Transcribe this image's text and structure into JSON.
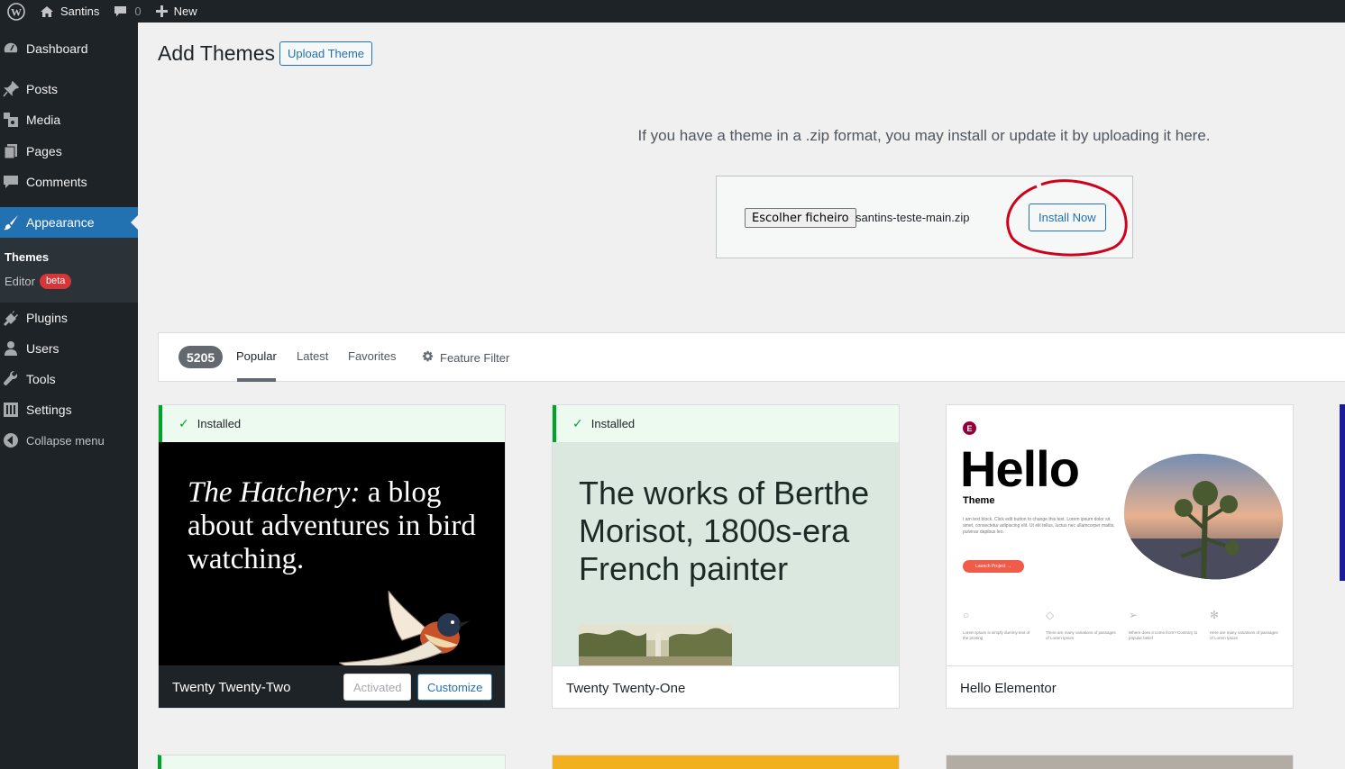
{
  "adminbar": {
    "site_name": "Santins",
    "comments_count": "0",
    "new_label": "New"
  },
  "sidebar": {
    "items": [
      {
        "label": "Dashboard",
        "icon": "dashboard-icon"
      },
      {
        "label": "Posts",
        "icon": "pin-icon"
      },
      {
        "label": "Media",
        "icon": "media-icon"
      },
      {
        "label": "Pages",
        "icon": "pages-icon"
      },
      {
        "label": "Comments",
        "icon": "comment-icon"
      },
      {
        "label": "Appearance",
        "icon": "brush-icon"
      },
      {
        "label": "Plugins",
        "icon": "plug-icon"
      },
      {
        "label": "Users",
        "icon": "user-icon"
      },
      {
        "label": "Tools",
        "icon": "wrench-icon"
      },
      {
        "label": "Settings",
        "icon": "settings-icon"
      },
      {
        "label": "Collapse menu",
        "icon": "collapse-icon"
      }
    ],
    "submenu": {
      "themes": "Themes",
      "editor": "Editor",
      "editor_badge": "beta"
    }
  },
  "header": {
    "title": "Add Themes",
    "upload_button": "Upload Theme"
  },
  "upload": {
    "help_text": "If you have a theme in a .zip format, you may install or update it by uploading it here.",
    "choose_file_button": "Escolher ficheiro",
    "file_name": "santins-teste-main.zip",
    "install_button": "Install Now"
  },
  "filter": {
    "count": "5205",
    "tabs": [
      "Popular",
      "Latest",
      "Favorites"
    ],
    "active_tab": "Popular",
    "feature_filter": "Feature Filter"
  },
  "themes": [
    {
      "name": "Twenty Twenty-Two",
      "notice": "Installed",
      "preview_text_italic": "The Hatchery:",
      "preview_text_rest": " a blog about adventures in bird watching.",
      "activated_label": "Activated",
      "customize_label": "Customize"
    },
    {
      "name": "Twenty Twenty-One",
      "notice": "Installed",
      "preview_text": "The works of Berthe Morisot, 1800s-era French painter"
    },
    {
      "name": "Hello Elementor",
      "preview_title": "Hello",
      "preview_subtitle": "Theme",
      "preview_paragraph": "I am text block. Click edit button to change this text. Lorem ipsum dolor sit amet, consectetur adipiscing elit. Ut elit tellus, luctus nec ullamcorper mattis, pulvinar dapibus leo.",
      "preview_button": "Launch Project →",
      "preview_features": [
        "Lorem Ipsum is simply dummy text of the printing",
        "There are many variations of passages of Lorem Ipsum",
        "Where does it come from? Contrary to popular belief",
        "Here are many variations of passages of Lorem Ipsum"
      ]
    }
  ],
  "colors": {
    "admin_dark": "#1d2327",
    "accent": "#2271b1",
    "installed_green": "#00a32a",
    "annotation_red": "#d0021b"
  }
}
